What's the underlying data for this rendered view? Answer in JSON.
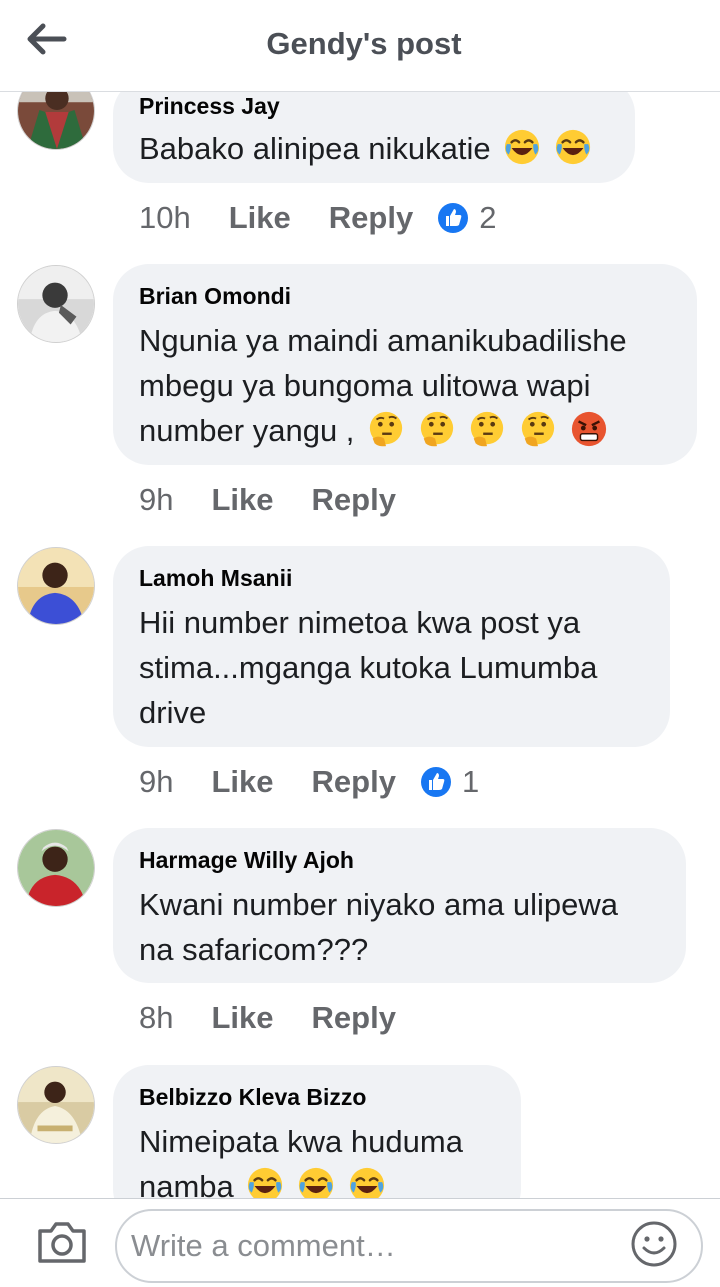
{
  "header": {
    "title": "Gendy's post",
    "back_icon": "arrow-left-icon"
  },
  "comments": [
    {
      "author": "Princess Jay",
      "text": "Babako alinipea nikukatie",
      "emojis": [
        "joy",
        "joy"
      ],
      "time": "10h",
      "like": "Like",
      "reply": "Reply",
      "reactions": "2"
    },
    {
      "author": "Brian Omondi",
      "text": "Ngunia ya maindi amanikubadilishe mbegu ya bungoma ulitowa wapi number yangu ,",
      "emojis": [
        "thinking",
        "thinking",
        "thinking",
        "thinking",
        "angry"
      ],
      "time": "9h",
      "like": "Like",
      "reply": "Reply"
    },
    {
      "author": "Lamoh Msanii",
      "text": "Hii number nimetoa kwa post ya stima...mganga kutoka Lumumba drive",
      "time": "9h",
      "like": "Like",
      "reply": "Reply",
      "reactions": "1"
    },
    {
      "author": "Harmage Willy Ajoh",
      "text": "Kwani number niyako ama ulipewa na safaricom???",
      "time": "8h",
      "like": "Like",
      "reply": "Reply"
    },
    {
      "author": "Belbizzo Kleva Bizzo",
      "text": "Nimeipata kwa huduma namba",
      "emojis": [
        "joy",
        "joy",
        "joy"
      ]
    }
  ],
  "footer": {
    "placeholder": "Write a comment…",
    "camera_icon": "camera-icon",
    "emoji_icon": "smiley-icon"
  },
  "colors": {
    "bubble": "#f0f2f5",
    "like_blue": "#1877f2",
    "meta_gray": "#65676b"
  }
}
